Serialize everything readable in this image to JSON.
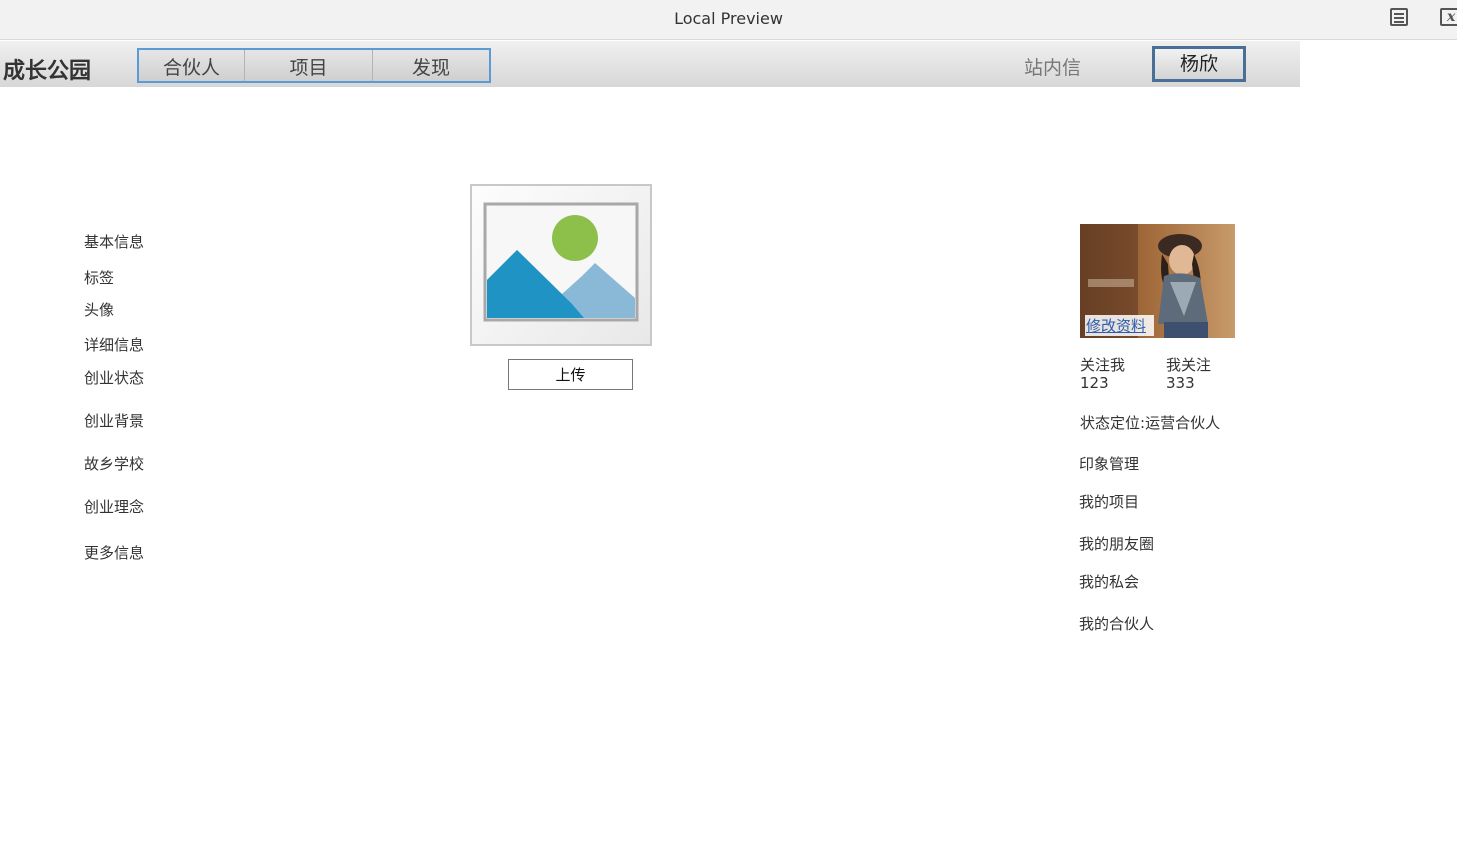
{
  "window": {
    "title": "Local Preview"
  },
  "navbar": {
    "brand": "成长公园",
    "items": [
      {
        "label": "合伙人"
      },
      {
        "label": "项目"
      },
      {
        "label": "发现"
      }
    ],
    "mail": "站内信",
    "user": "杨欣"
  },
  "sidebar": {
    "items": [
      {
        "label": "基本信息"
      },
      {
        "label": "标签"
      },
      {
        "label": "头像"
      },
      {
        "label": "详细信息"
      },
      {
        "label": "创业状态"
      },
      {
        "label": "创业背景"
      },
      {
        "label": "故乡学校"
      },
      {
        "label": "创业理念"
      },
      {
        "label": "更多信息"
      }
    ]
  },
  "avatar_panel": {
    "upload_label": "上传"
  },
  "profile": {
    "edit_label": "修改资料",
    "followers_label": "关注我",
    "followers_count": "123",
    "following_label": "我关注",
    "following_count": "333",
    "status_label": "状态定位:",
    "status_value": "运营合伙人",
    "links": [
      {
        "label": "印象管理"
      },
      {
        "label": "我的项目"
      },
      {
        "label": "我的朋友圈"
      },
      {
        "label": "我的私会"
      },
      {
        "label": "我的合伙人"
      }
    ]
  }
}
